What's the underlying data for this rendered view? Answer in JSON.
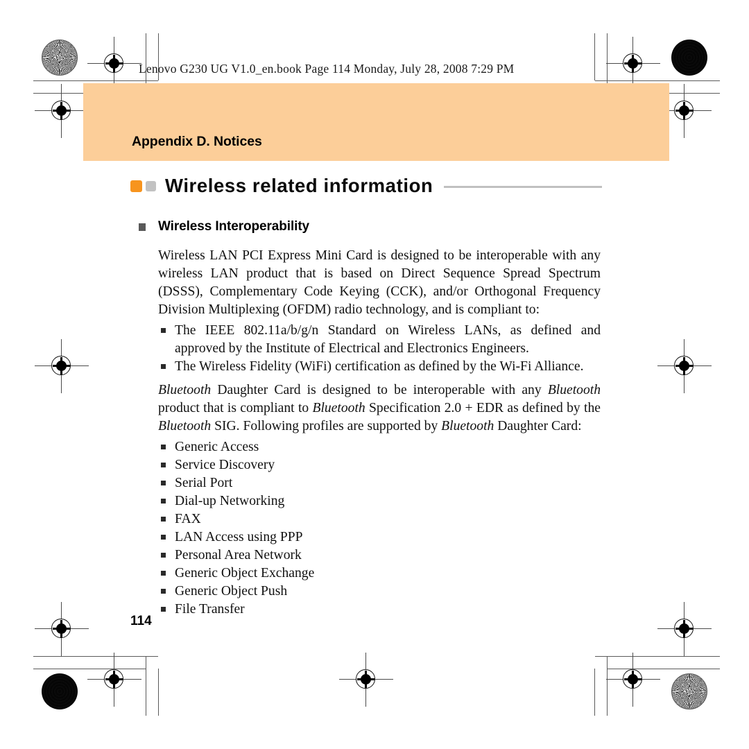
{
  "document": {
    "book_header": "Lenovo G230 UG V1.0_en.book  Page 114  Monday, July 28, 2008  7:29 PM",
    "appendix_banner": "Appendix D. Notices",
    "chapter_title": "Wireless related information",
    "section_heading": "Wireless Interoperability",
    "page_number": "114",
    "paragraph_1": "Wireless LAN PCI Express Mini Card is designed to be interoperable with any wireless LAN product that is based on Direct Sequence Spread Spectrum (DSSS), Complementary Code Keying (CCK), and/or Orthogonal Frequency Division Multiplexing (OFDM) radio technology, and is compliant to:",
    "standards_bullets": [
      "The IEEE 802.11a/b/g/n Standard on Wireless LANs, as defined and approved by the Institute of Electrical and Electronics Engineers.",
      "The Wireless Fidelity (WiFi) certification as defined by the Wi-Fi Alliance."
    ],
    "bluetooth_paragraph": {
      "seg_1_italic": "Bluetooth",
      "seg_2": " Daughter Card is designed to be interoperable with any ",
      "seg_3_italic": "Bluetooth",
      "seg_4": " product that is compliant to ",
      "seg_5_italic": "Bluetooth",
      "seg_6": " Specification 2.0 + EDR as defined by the ",
      "seg_7_italic": "Bluetooth",
      "seg_8": " SIG. Following profiles are supported by ",
      "seg_9_italic": "Bluetooth",
      "seg_10": " Daughter Card:"
    },
    "profile_bullets": [
      "Generic Access",
      "Service Discovery",
      "Serial Port",
      "Dial-up Networking",
      "FAX",
      "LAN Access using PPP",
      "Personal Area Network",
      "Generic Object Exchange",
      "Generic Object Push",
      "File Transfer"
    ]
  },
  "colors": {
    "banner_orange": "#fcce99",
    "accent_orange_square": "#f7941e",
    "accent_gray_square": "#c2c2c2",
    "title_rule_gray": "#c0c0c0",
    "section_marker_gray": "#595959",
    "text_black": "#111111"
  }
}
